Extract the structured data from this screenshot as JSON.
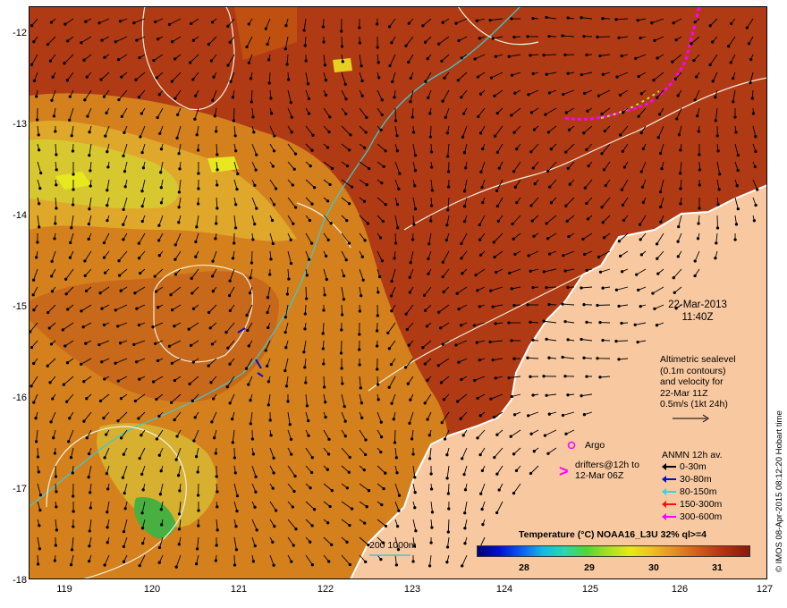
{
  "map": {
    "y_ticks": [
      "-12",
      "-13",
      "-14",
      "-15",
      "-16",
      "-17",
      "-18"
    ],
    "x_ticks": [
      "119",
      "120",
      "121",
      "122",
      "123",
      "124",
      "125",
      "126",
      "127"
    ],
    "date": "22-Mar-2013",
    "time": "11:40Z",
    "altimetry_lines": [
      "Altimetric sealevel",
      "(0.1m contours)",
      "and velocity for",
      "22-Mar 11Z",
      "0.5m/s (1kt 24h)"
    ],
    "argo_label": "Argo",
    "drifters_lines": [
      "drifters@12h to",
      "12-Mar 06Z"
    ],
    "anmn_title": "ANMN 12h av.",
    "anmn_legend": [
      {
        "label": "0-30m",
        "color": "#000000"
      },
      {
        "label": "30-80m",
        "color": "#0010d0"
      },
      {
        "label": "80-150m",
        "color": "#20e0e0"
      },
      {
        "label": "150-300m",
        "color": "#ff1010"
      },
      {
        "label": "300-600m",
        "color": "#ff00ff"
      }
    ],
    "colorbar_title": "Temperature (°C) NOAA16_L3U 32% ql>=4",
    "colorbar_ticks": [
      "28",
      "29",
      "30",
      "31"
    ],
    "depth_label": "200  1000m",
    "credit": "© IMOS 08-Apr-2015 08:12:20 Hobart time",
    "colors": {
      "warm": "#b03a14",
      "mid": "#d4801c",
      "cool": "#e8c020",
      "land": "#f8c8a0",
      "bathymetry": "#40c8c8",
      "sealevel_contour": "#f0f0e0"
    }
  }
}
